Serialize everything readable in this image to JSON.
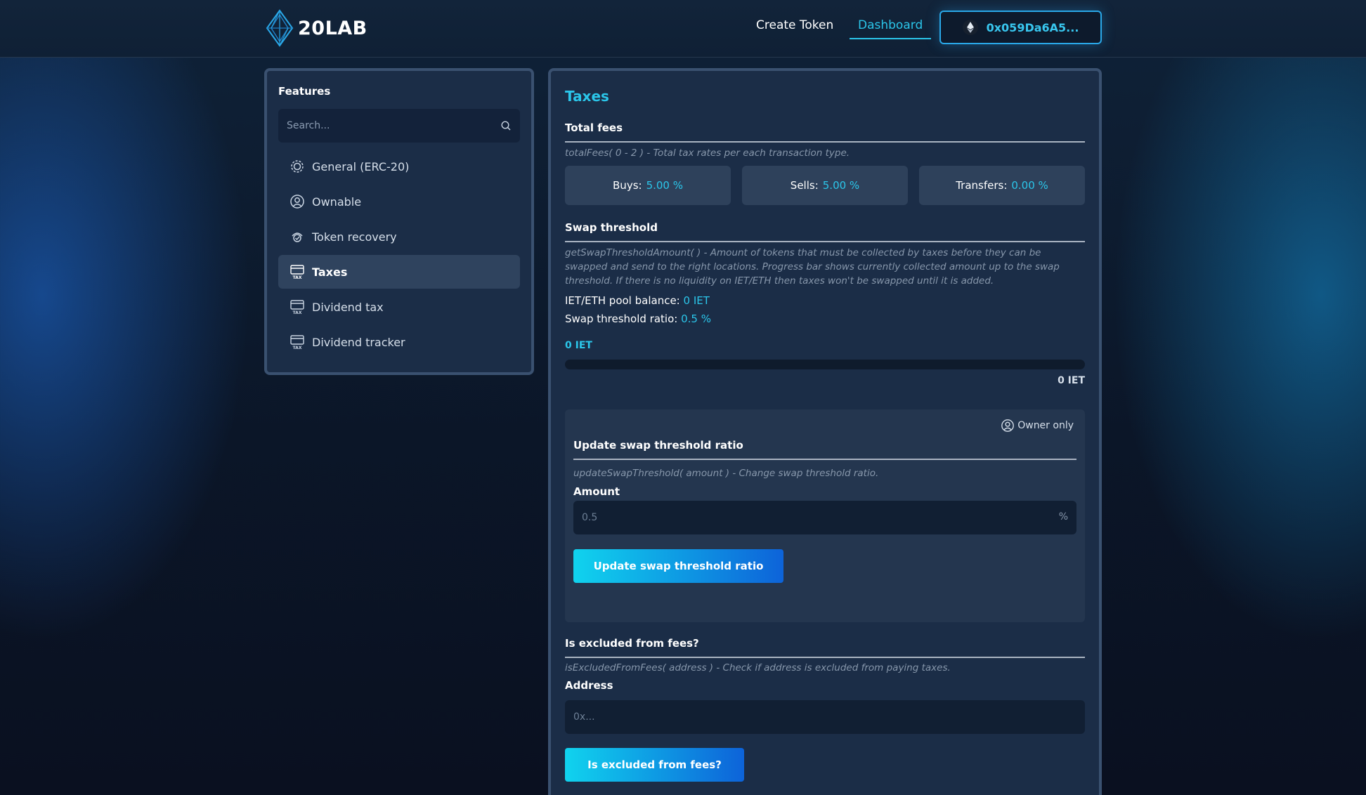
{
  "header": {
    "logo_text": "20LAB",
    "nav": {
      "create_token": "Create Token",
      "dashboard": "Dashboard"
    },
    "wallet": {
      "address": "0x059Da6A5...",
      "icon": "ethereum-icon"
    }
  },
  "sidebar": {
    "title": "Features",
    "search_placeholder": "Search...",
    "items": [
      {
        "label": "General (ERC-20)",
        "icon": "gear-icon"
      },
      {
        "label": "Ownable",
        "icon": "user-circle-icon"
      },
      {
        "label": "Token recovery",
        "icon": "recovery-icon"
      },
      {
        "label": "Taxes",
        "icon": "tax-icon",
        "active": true
      },
      {
        "label": "Dividend tax",
        "icon": "tax-icon"
      },
      {
        "label": "Dividend tracker",
        "icon": "tax-icon"
      }
    ]
  },
  "main": {
    "title": "Taxes",
    "total_fees": {
      "title": "Total fees",
      "desc": "totalFees( 0 - 2 ) - Total tax rates per each transaction type.",
      "buys": {
        "label": "Buys:",
        "value": "5.00 %"
      },
      "sells": {
        "label": "Sells:",
        "value": "5.00 %"
      },
      "transfers": {
        "label": "Transfers:",
        "value": "0.00 %"
      }
    },
    "swap_threshold": {
      "title": "Swap threshold",
      "desc": "getSwapThresholdAmount( ) - Amount of tokens that must be collected by taxes before they can be swapped and send to the right locations. Progress bar shows currently collected amount up to the swap threshold. If there is no liquidity on IET/ETH then taxes won't be swapped until it is added.",
      "pool_label": "IET/ETH pool balance:",
      "pool_value": "0 IET",
      "ratio_label": "Swap threshold ratio:",
      "ratio_value": "0.5 %",
      "progress_current": "0 IET",
      "progress_max": "0 IET",
      "progress_fraction": 0
    },
    "update_swap": {
      "owner_badge": "Owner only",
      "title": "Update swap threshold ratio",
      "desc": "updateSwapThreshold( amount ) - Change swap threshold ratio.",
      "amount_label": "Amount",
      "amount_placeholder": "0.5",
      "amount_suffix": "%",
      "button": "Update swap threshold ratio"
    },
    "excluded": {
      "title": "Is excluded from fees?",
      "desc": "isExcludedFromFees( address ) - Check if address is excluded from paying taxes.",
      "address_label": "Address",
      "address_placeholder": "0x...",
      "button": "Is excluded from fees?"
    }
  }
}
